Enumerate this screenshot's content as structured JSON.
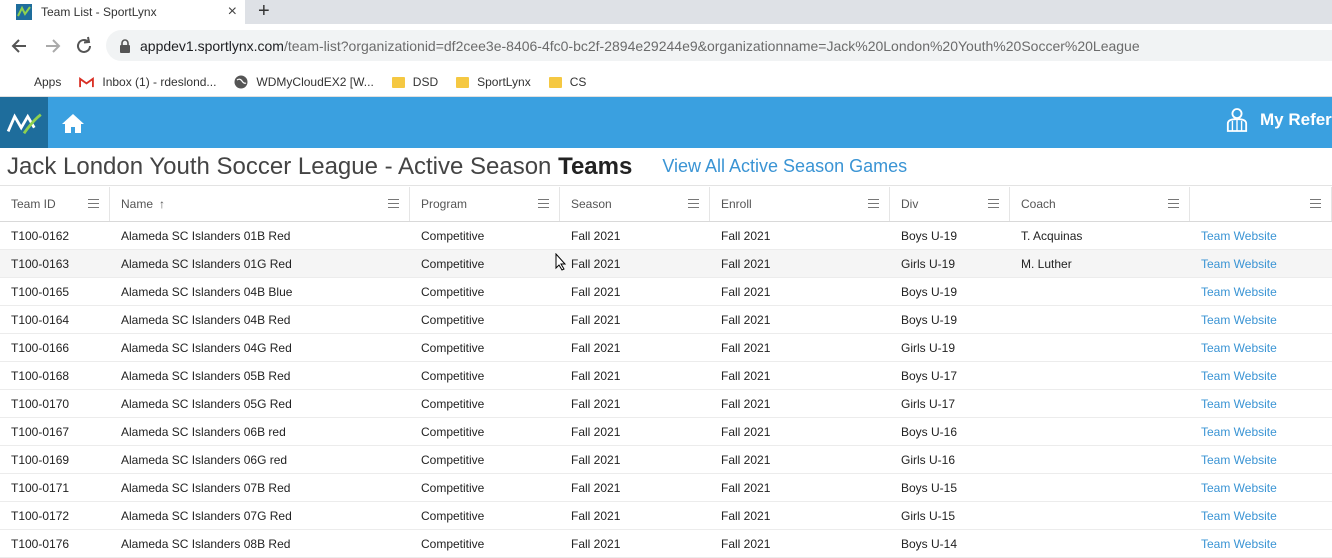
{
  "browser": {
    "tab_title": "Team List - SportLynx",
    "tab_close": "×",
    "new_tab": "+",
    "url_host": "appdev1.sportlynx.com",
    "url_path": "/team-list?organizationid=df2cee3e-8406-4fc0-bc2f-2894e29244e9&organizationname=Jack%20London%20Youth%20Soccer%20League",
    "bookmarks": [
      {
        "label": "Apps",
        "icon": "apps-icon"
      },
      {
        "label": "Inbox (1) - rdeslond...",
        "icon": "gmail-icon"
      },
      {
        "label": "WDMyCloudEX2 [W...",
        "icon": "globe-icon"
      },
      {
        "label": "DSD",
        "icon": "folder-icon"
      },
      {
        "label": "SportLynx",
        "icon": "folder-icon"
      },
      {
        "label": "CS",
        "icon": "folder-icon"
      }
    ]
  },
  "header": {
    "user_label": "My Refere",
    "brand_color": "#3aa0e0"
  },
  "page": {
    "title_main": "Jack London Youth Soccer League - Active Season ",
    "title_bold": "Teams",
    "view_games_link": "View All Active Season Games"
  },
  "grid": {
    "columns": [
      "Team ID",
      "Name",
      "Program",
      "Season",
      "Enroll",
      "Div",
      "Coach",
      ""
    ],
    "sort_indicator": "↑",
    "link_label": "Team Website",
    "rows": [
      [
        "T100-0162",
        "Alameda SC Islanders 01B Red",
        "Competitive",
        "Fall 2021",
        "Fall 2021",
        "Boys U-19",
        "T. Acquinas"
      ],
      [
        "T100-0163",
        "Alameda SC Islanders 01G Red",
        "Competitive",
        "Fall 2021",
        "Fall 2021",
        "Girls U-19",
        "M. Luther"
      ],
      [
        "T100-0165",
        "Alameda SC Islanders 04B Blue",
        "Competitive",
        "Fall 2021",
        "Fall 2021",
        "Boys U-19",
        ""
      ],
      [
        "T100-0164",
        "Alameda SC Islanders 04B Red",
        "Competitive",
        "Fall 2021",
        "Fall 2021",
        "Boys U-19",
        ""
      ],
      [
        "T100-0166",
        "Alameda SC Islanders 04G Red",
        "Competitive",
        "Fall 2021",
        "Fall 2021",
        "Girls U-19",
        ""
      ],
      [
        "T100-0168",
        "Alameda SC Islanders 05B Red",
        "Competitive",
        "Fall 2021",
        "Fall 2021",
        "Boys U-17",
        ""
      ],
      [
        "T100-0170",
        "Alameda SC Islanders 05G Red",
        "Competitive",
        "Fall 2021",
        "Fall 2021",
        "Girls U-17",
        ""
      ],
      [
        "T100-0167",
        "Alameda SC Islanders 06B red",
        "Competitive",
        "Fall 2021",
        "Fall 2021",
        "Boys U-16",
        ""
      ],
      [
        "T100-0169",
        "Alameda SC Islanders 06G red",
        "Competitive",
        "Fall 2021",
        "Fall 2021",
        "Girls U-16",
        ""
      ],
      [
        "T100-0171",
        "Alameda SC Islanders 07B Red",
        "Competitive",
        "Fall 2021",
        "Fall 2021",
        "Boys U-15",
        ""
      ],
      [
        "T100-0172",
        "Alameda SC Islanders 07G Red",
        "Competitive",
        "Fall 2021",
        "Fall 2021",
        "Girls U-15",
        ""
      ],
      [
        "T100-0176",
        "Alameda SC Islanders 08B Red",
        "Competitive",
        "Fall 2021",
        "Fall 2021",
        "Boys U-14",
        ""
      ]
    ]
  }
}
